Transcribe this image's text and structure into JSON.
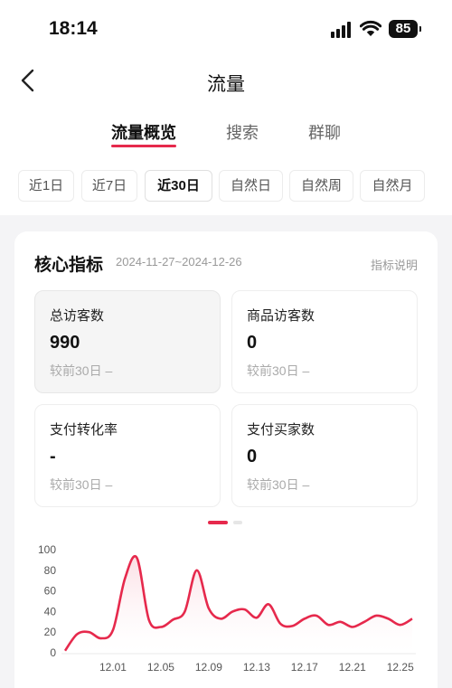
{
  "status_bar": {
    "time": "18:14",
    "battery": "85"
  },
  "header": {
    "title": "流量"
  },
  "tabs": [
    {
      "label": "流量概览",
      "active": true
    },
    {
      "label": "搜索",
      "active": false
    },
    {
      "label": "群聊",
      "active": false
    }
  ],
  "ranges": [
    {
      "label": "近1日",
      "active": false
    },
    {
      "label": "近7日",
      "active": false
    },
    {
      "label": "近30日",
      "active": true
    },
    {
      "label": "自然日",
      "active": false
    },
    {
      "label": "自然周",
      "active": false
    },
    {
      "label": "自然月",
      "active": false
    }
  ],
  "core": {
    "title": "核心指标",
    "date_range": "2024-11-27~2024-12-26",
    "help_link": "指标说明",
    "metrics": [
      {
        "label": "总访客数",
        "value": "990",
        "compare": "较前30日 –",
        "selected": true
      },
      {
        "label": "商品访客数",
        "value": "0",
        "compare": "较前30日 –",
        "selected": false
      },
      {
        "label": "支付转化率",
        "value": "-",
        "compare": "较前30日 –",
        "selected": false
      },
      {
        "label": "支付买家数",
        "value": "0",
        "compare": "较前30日 –",
        "selected": false
      }
    ]
  },
  "colors": {
    "accent": "#e6294c",
    "area_fill": "#fbdde3"
  },
  "chart_data": {
    "type": "area",
    "x": [
      "11.27",
      "11.28",
      "11.29",
      "11.30",
      "12.01",
      "12.02",
      "12.03",
      "12.04",
      "12.05",
      "12.06",
      "12.07",
      "12.08",
      "12.09",
      "12.10",
      "12.11",
      "12.12",
      "12.13",
      "12.14",
      "12.15",
      "12.16",
      "12.17",
      "12.18",
      "12.19",
      "12.20",
      "12.21",
      "12.22",
      "12.23",
      "12.24",
      "12.25",
      "12.26"
    ],
    "series": [
      {
        "values": [
          2,
          18,
          20,
          14,
          22,
          72,
          92,
          32,
          25,
          32,
          40,
          80,
          43,
          33,
          40,
          42,
          34,
          47,
          28,
          26,
          33,
          36,
          27,
          30,
          25,
          30,
          36,
          33,
          27,
          33
        ]
      }
    ],
    "xticks": [
      "12.01",
      "12.05",
      "12.09",
      "12.13",
      "12.17",
      "12.21",
      "12.25"
    ],
    "yticks": [
      0,
      20,
      40,
      60,
      80,
      100
    ],
    "ylim": [
      0,
      100
    ],
    "grid": false
  }
}
